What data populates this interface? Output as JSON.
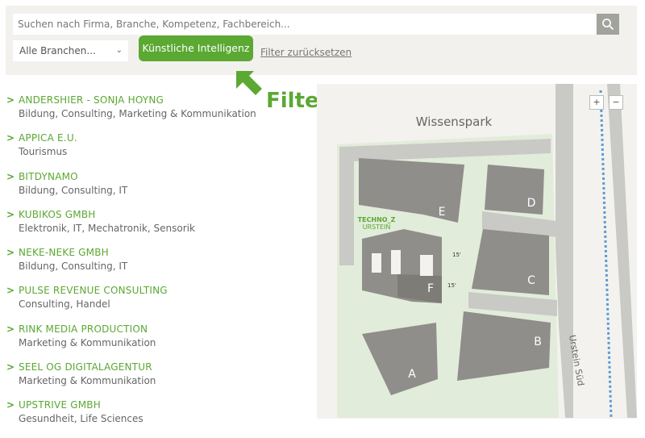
{
  "filter": {
    "search_placeholder": "Suchen nach Firma, Branche, Kompetenz, Fachbereich...",
    "branch_select": "Alle Branchen...",
    "active_chip": "Künstliche Intelligenz",
    "reset_label": "Filter zurücksetzen"
  },
  "annotation": {
    "label": "Filter"
  },
  "companies": [
    {
      "name": "ANDERSHIER - SONJA HOYNG",
      "category": "Bildung, Consulting, Marketing & Kommunikation"
    },
    {
      "name": "APPICA E.U.",
      "category": "Tourismus"
    },
    {
      "name": "BITDYNAMO",
      "category": "Bildung, Consulting, IT"
    },
    {
      "name": "KUBIKOS GMBH",
      "category": "Elektronik, IT, Mechatronik, Sensorik"
    },
    {
      "name": "NEKE-NEKE GMBH",
      "category": "Bildung, Consulting, IT"
    },
    {
      "name": "PULSE REVENUE CONSULTING",
      "category": "Consulting, Handel"
    },
    {
      "name": "RINK MEDIA PRODUCTION",
      "category": "Marketing & Kommunikation"
    },
    {
      "name": "SEEL OG DIGITALAGENTUR",
      "category": "Marketing & Kommunikation"
    },
    {
      "name": "UPSTRIVE GMBH",
      "category": "Gesundheit, Life Sciences"
    }
  ],
  "map": {
    "area_label": "Wissenspark",
    "street_label": "Urstein Süd",
    "logo_line1": "TECHNO_Z",
    "logo_line2": "URSTEIN",
    "buildings": [
      "A",
      "B",
      "C",
      "D",
      "E",
      "F"
    ],
    "level_top": "15'",
    "level_bottom": "15'",
    "zoom_in": "+",
    "zoom_out": "−"
  },
  "colors": {
    "accent": "#5ba833",
    "building": "#8f8e8a",
    "road": "#c9c9c6",
    "green_area": "#e2ecda",
    "path": "#5b9bd5"
  }
}
